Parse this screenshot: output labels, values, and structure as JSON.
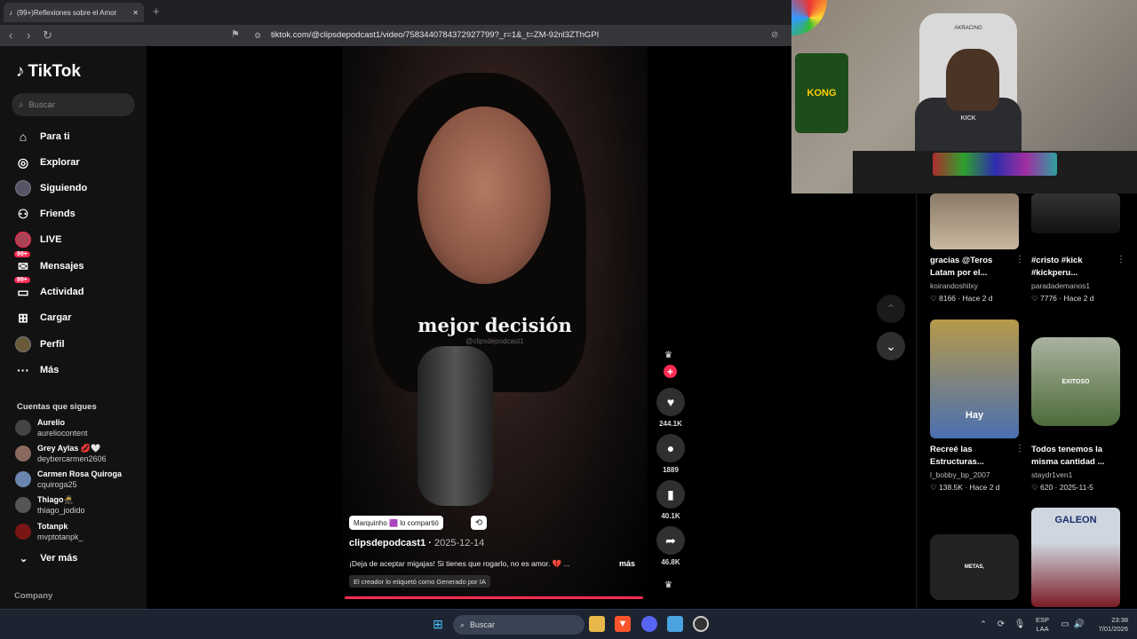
{
  "browser": {
    "tab_title": "(99+)Reflexiones sobre el Amor",
    "url": "tiktok.com/@clipsdepodcast1/video/7583440784372927799?_r=1&_t=ZM-92nl3ZThGPI"
  },
  "sidebar": {
    "brand": "TikTok",
    "search_placeholder": "Buscar",
    "nav": [
      {
        "label": "Para ti",
        "icon": "home-icon"
      },
      {
        "label": "Explorar",
        "icon": "compass-icon"
      },
      {
        "label": "Siguiendo",
        "icon": "avatar"
      },
      {
        "label": "Friends",
        "icon": "friends-icon"
      },
      {
        "label": "LIVE",
        "icon": "live-avatar"
      },
      {
        "label": "Mensajes",
        "icon": "message-icon",
        "badge": "99+"
      },
      {
        "label": "Actividad",
        "icon": "activity-icon",
        "badge": "99+"
      },
      {
        "label": "Cargar",
        "icon": "upload-icon"
      },
      {
        "label": "Perfil",
        "icon": "profile-avatar"
      },
      {
        "label": "Más",
        "icon": "more-icon"
      }
    ],
    "following_heading": "Cuentas que sigues",
    "following": [
      {
        "name": "Aurelio",
        "user": "aureliocontent"
      },
      {
        "name": "Grey Aylas 💋🤍",
        "user": "deybercarmen2606"
      },
      {
        "name": "Carmen Rosa Quiroga",
        "user": "cquiroga25"
      },
      {
        "name": "Thiago🥷",
        "user": "thiago_jodido"
      },
      {
        "name": "Totanpk",
        "user": "mvptotanpk_"
      }
    ],
    "see_more": "Ver más",
    "company": "Company"
  },
  "video": {
    "overlay_text": "mejor decisión",
    "watermark": "@clipsdepodcast1",
    "shared_by": "Marquinho 🟪 lo compartió",
    "author": "clipsdepodcast1",
    "date": "2025-12-14",
    "caption": "¡Deja de aceptar migajas! Si tienes que rogarlo, no es amor. 💔 ...",
    "more": "más",
    "ai_label": "El creador lo etiquetó como Generado por IA"
  },
  "actions": {
    "likes": "244.1K",
    "comments": "1889",
    "saves": "40.1K",
    "shares": "46.8K"
  },
  "related": [
    {
      "title": "gracias @Teros Latam por el...",
      "user": "koirandoshilxy",
      "likes": "8166",
      "age": "Hace 2 d"
    },
    {
      "title": "#cristo #kick #kickperu...",
      "user": "paradademanos1",
      "likes": "7776",
      "age": "Hace 2 d"
    },
    {
      "title": "Recreé las Estructuras...",
      "user": "l_bobby_bp_2007",
      "likes": "138.5K",
      "age": "Hace 2 d",
      "thumb_text": "Hay"
    },
    {
      "title": "Todos tenemos la misma cantidad ...",
      "user": "staydr1ven1",
      "likes": "620",
      "age": "2025-11-5",
      "thumb_text": "EXITOSO"
    },
    {
      "thumb_text": "METAS,"
    },
    {
      "thumb_text": "GALEON"
    }
  ],
  "webcam": {
    "sign": "KONG",
    "chair_brand": "AKRACING",
    "shirt_brand": "KICK"
  },
  "taskbar": {
    "search_placeholder": "Buscar",
    "lang_line1": "ESP",
    "lang_line2": "LAA",
    "time": "23:38",
    "date": "7/01/2026"
  }
}
